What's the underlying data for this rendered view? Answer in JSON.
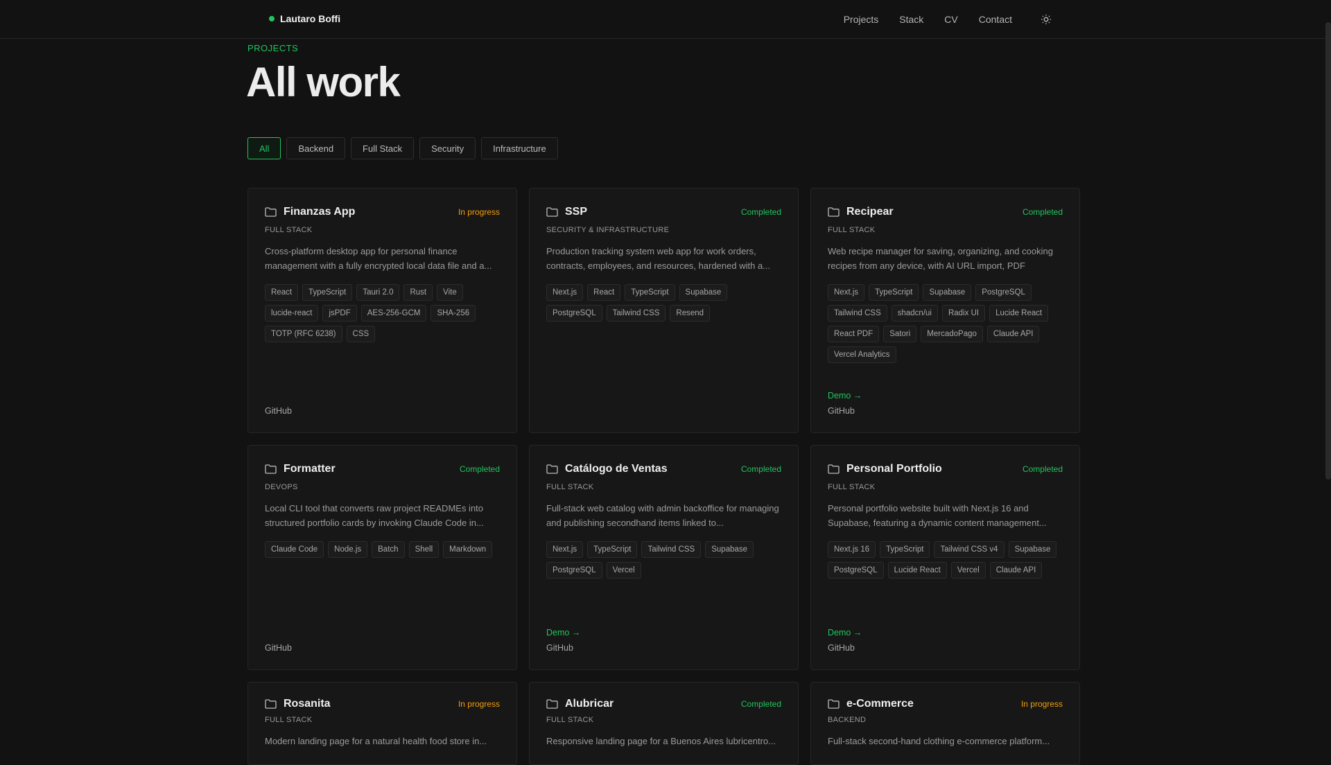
{
  "brand": {
    "name": "Lautaro Boffi"
  },
  "nav": {
    "items": [
      "Projects",
      "Stack",
      "CV",
      "Contact"
    ]
  },
  "header": {
    "eyebrow": "PROJECTS",
    "title": "All work"
  },
  "filters": [
    "All",
    "Backend",
    "Full Stack",
    "Security",
    "Infrastructure"
  ],
  "active_filter": "All",
  "colors": {
    "accent": "#22c55e",
    "in_progress": "#f59e0b",
    "background": "#121212"
  },
  "projects": [
    {
      "title": "Finanzas App",
      "status": "In progress",
      "category": "FULL STACK",
      "description": "Cross-platform desktop app for personal finance management with a fully encrypted local data file and a...",
      "tags": [
        "React",
        "TypeScript",
        "Tauri 2.0",
        "Rust",
        "Vite",
        "lucide-react",
        "jsPDF",
        "AES-256-GCM",
        "SHA-256",
        "TOTP (RFC 6238)",
        "CSS"
      ],
      "demo": "",
      "github": "GitHub"
    },
    {
      "title": "SSP",
      "status": "Completed",
      "category": "SECURITY & INFRASTRUCTURE",
      "description": "Production tracking system web app for work orders, contracts, employees, and resources, hardened with a...",
      "tags": [
        "Next.js",
        "React",
        "TypeScript",
        "Supabase",
        "PostgreSQL",
        "Tailwind CSS",
        "Resend"
      ],
      "demo": "",
      "github": ""
    },
    {
      "title": "Recipear",
      "status": "Completed",
      "category": "FULL STACK",
      "description": "Web recipe manager for saving, organizing, and cooking recipes from any device, with AI URL import, PDF export,...",
      "tags": [
        "Next.js",
        "TypeScript",
        "Supabase",
        "PostgreSQL",
        "Tailwind CSS",
        "shadcn/ui",
        "Radix UI",
        "Lucide React",
        "React PDF",
        "Satori",
        "MercadoPago",
        "Claude API",
        "Vercel Analytics"
      ],
      "demo": "Demo →",
      "github": "GitHub"
    },
    {
      "title": "Formatter",
      "status": "Completed",
      "category": "DEVOPS",
      "description": "Local CLI tool that converts raw project READMEs into structured portfolio cards by invoking Claude Code in...",
      "tags": [
        "Claude Code",
        "Node.js",
        "Batch",
        "Shell",
        "Markdown"
      ],
      "demo": "",
      "github": "GitHub"
    },
    {
      "title": "Catálogo de Ventas",
      "status": "Completed",
      "category": "FULL STACK",
      "description": "Full-stack web catalog with admin backoffice for managing and publishing secondhand items linked to...",
      "tags": [
        "Next.js",
        "TypeScript",
        "Tailwind CSS",
        "Supabase",
        "PostgreSQL",
        "Vercel"
      ],
      "demo": "Demo →",
      "github": "GitHub"
    },
    {
      "title": "Personal Portfolio",
      "status": "Completed",
      "category": "FULL STACK",
      "description": "Personal portfolio website built with Next.js 16 and Supabase, featuring a dynamic content management...",
      "tags": [
        "Next.js 16",
        "TypeScript",
        "Tailwind CSS v4",
        "Supabase",
        "PostgreSQL",
        "Lucide React",
        "Vercel",
        "Claude API"
      ],
      "demo": "Demo →",
      "github": "GitHub"
    },
    {
      "title": "Rosanita",
      "status": "In progress",
      "category": "FULL STACK",
      "description": "Modern landing page for a natural health food store in...",
      "tags": [],
      "demo": "",
      "github": ""
    },
    {
      "title": "Alubricar",
      "status": "Completed",
      "category": "FULL STACK",
      "description": "Responsive landing page for a Buenos Aires lubricentro...",
      "tags": [],
      "demo": "",
      "github": ""
    },
    {
      "title": "e-Commerce",
      "status": "In progress",
      "category": "BACKEND",
      "description": "Full-stack second-hand clothing e-commerce platform...",
      "tags": [],
      "demo": "",
      "github": ""
    }
  ]
}
